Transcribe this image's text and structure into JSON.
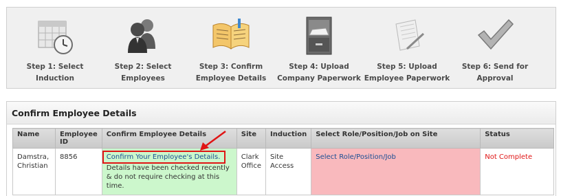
{
  "wizard": {
    "steps": [
      {
        "label": "Step 1: Select Induction",
        "icon": "calendar-clock-icon"
      },
      {
        "label": "Step 2: Select Employees",
        "icon": "people-icon"
      },
      {
        "label": "Step 3: Confirm Employee Details",
        "icon": "open-book-icon"
      },
      {
        "label": "Step 4: Upload Company Paperwork",
        "icon": "filing-cabinet-icon"
      },
      {
        "label": "Step 5: Upload Employee Paperwork",
        "icon": "document-pen-icon"
      },
      {
        "label": "Step 6: Send for Approval",
        "icon": "checkmark-icon"
      }
    ]
  },
  "panel": {
    "title": "Confirm Employee Details"
  },
  "table": {
    "headers": [
      "Name",
      "Employee ID",
      "Confirm Employee Details",
      "Site",
      "Induction",
      "Select Role/Position/Job on Site",
      "Status"
    ],
    "rows": [
      {
        "name": "Damstra, Christian",
        "employee_id": "8856",
        "confirm_link": "Confirm Your Employee's Details.",
        "confirm_note": "Details have been checked recently & do not require checking at this time.",
        "site": "Clark Office",
        "induction": "Site Access",
        "role_link": "Select Role/Position/Job",
        "status": "Not Complete"
      }
    ]
  },
  "colors": {
    "status_red": "#e01414",
    "link_blue": "#1a4e94",
    "confirm_bg": "#ccf7cc",
    "role_bg": "#f9b9bd"
  }
}
